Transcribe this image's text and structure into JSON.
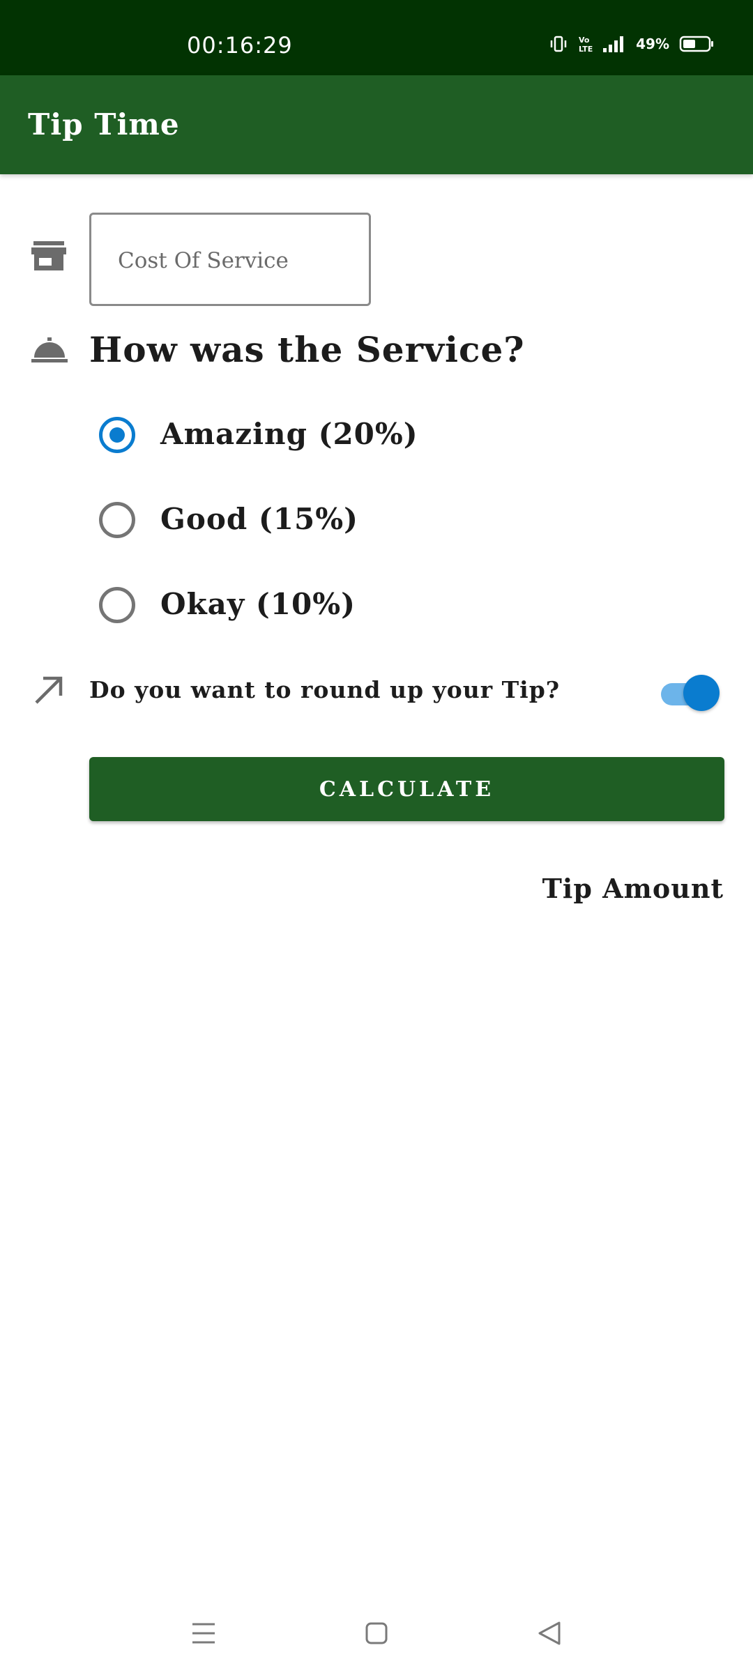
{
  "status_bar": {
    "time": "00:16:29",
    "battery": "49%"
  },
  "app_bar": {
    "title": "Tip Time"
  },
  "cost_input": {
    "placeholder": "Cost Of Service",
    "value": ""
  },
  "service_question": "How was the Service?",
  "tip_options": [
    {
      "label": "Amazing (20%)",
      "selected": true
    },
    {
      "label": "Good (15%)",
      "selected": false
    },
    {
      "label": "Okay (10%)",
      "selected": false
    }
  ],
  "round_up": {
    "label": "Do you want to round up your Tip?",
    "enabled": true
  },
  "calculate_button": "CALCULATE",
  "tip_amount_label": "Tip Amount",
  "colors": {
    "status_bar": "#023302",
    "app_bar": "#1f5e24",
    "accent": "#0a7ccf",
    "button": "#1f5e24"
  },
  "icons": {
    "cost": "storefront-icon",
    "service": "room-service-icon",
    "round_up": "arrow-up-right-icon"
  }
}
